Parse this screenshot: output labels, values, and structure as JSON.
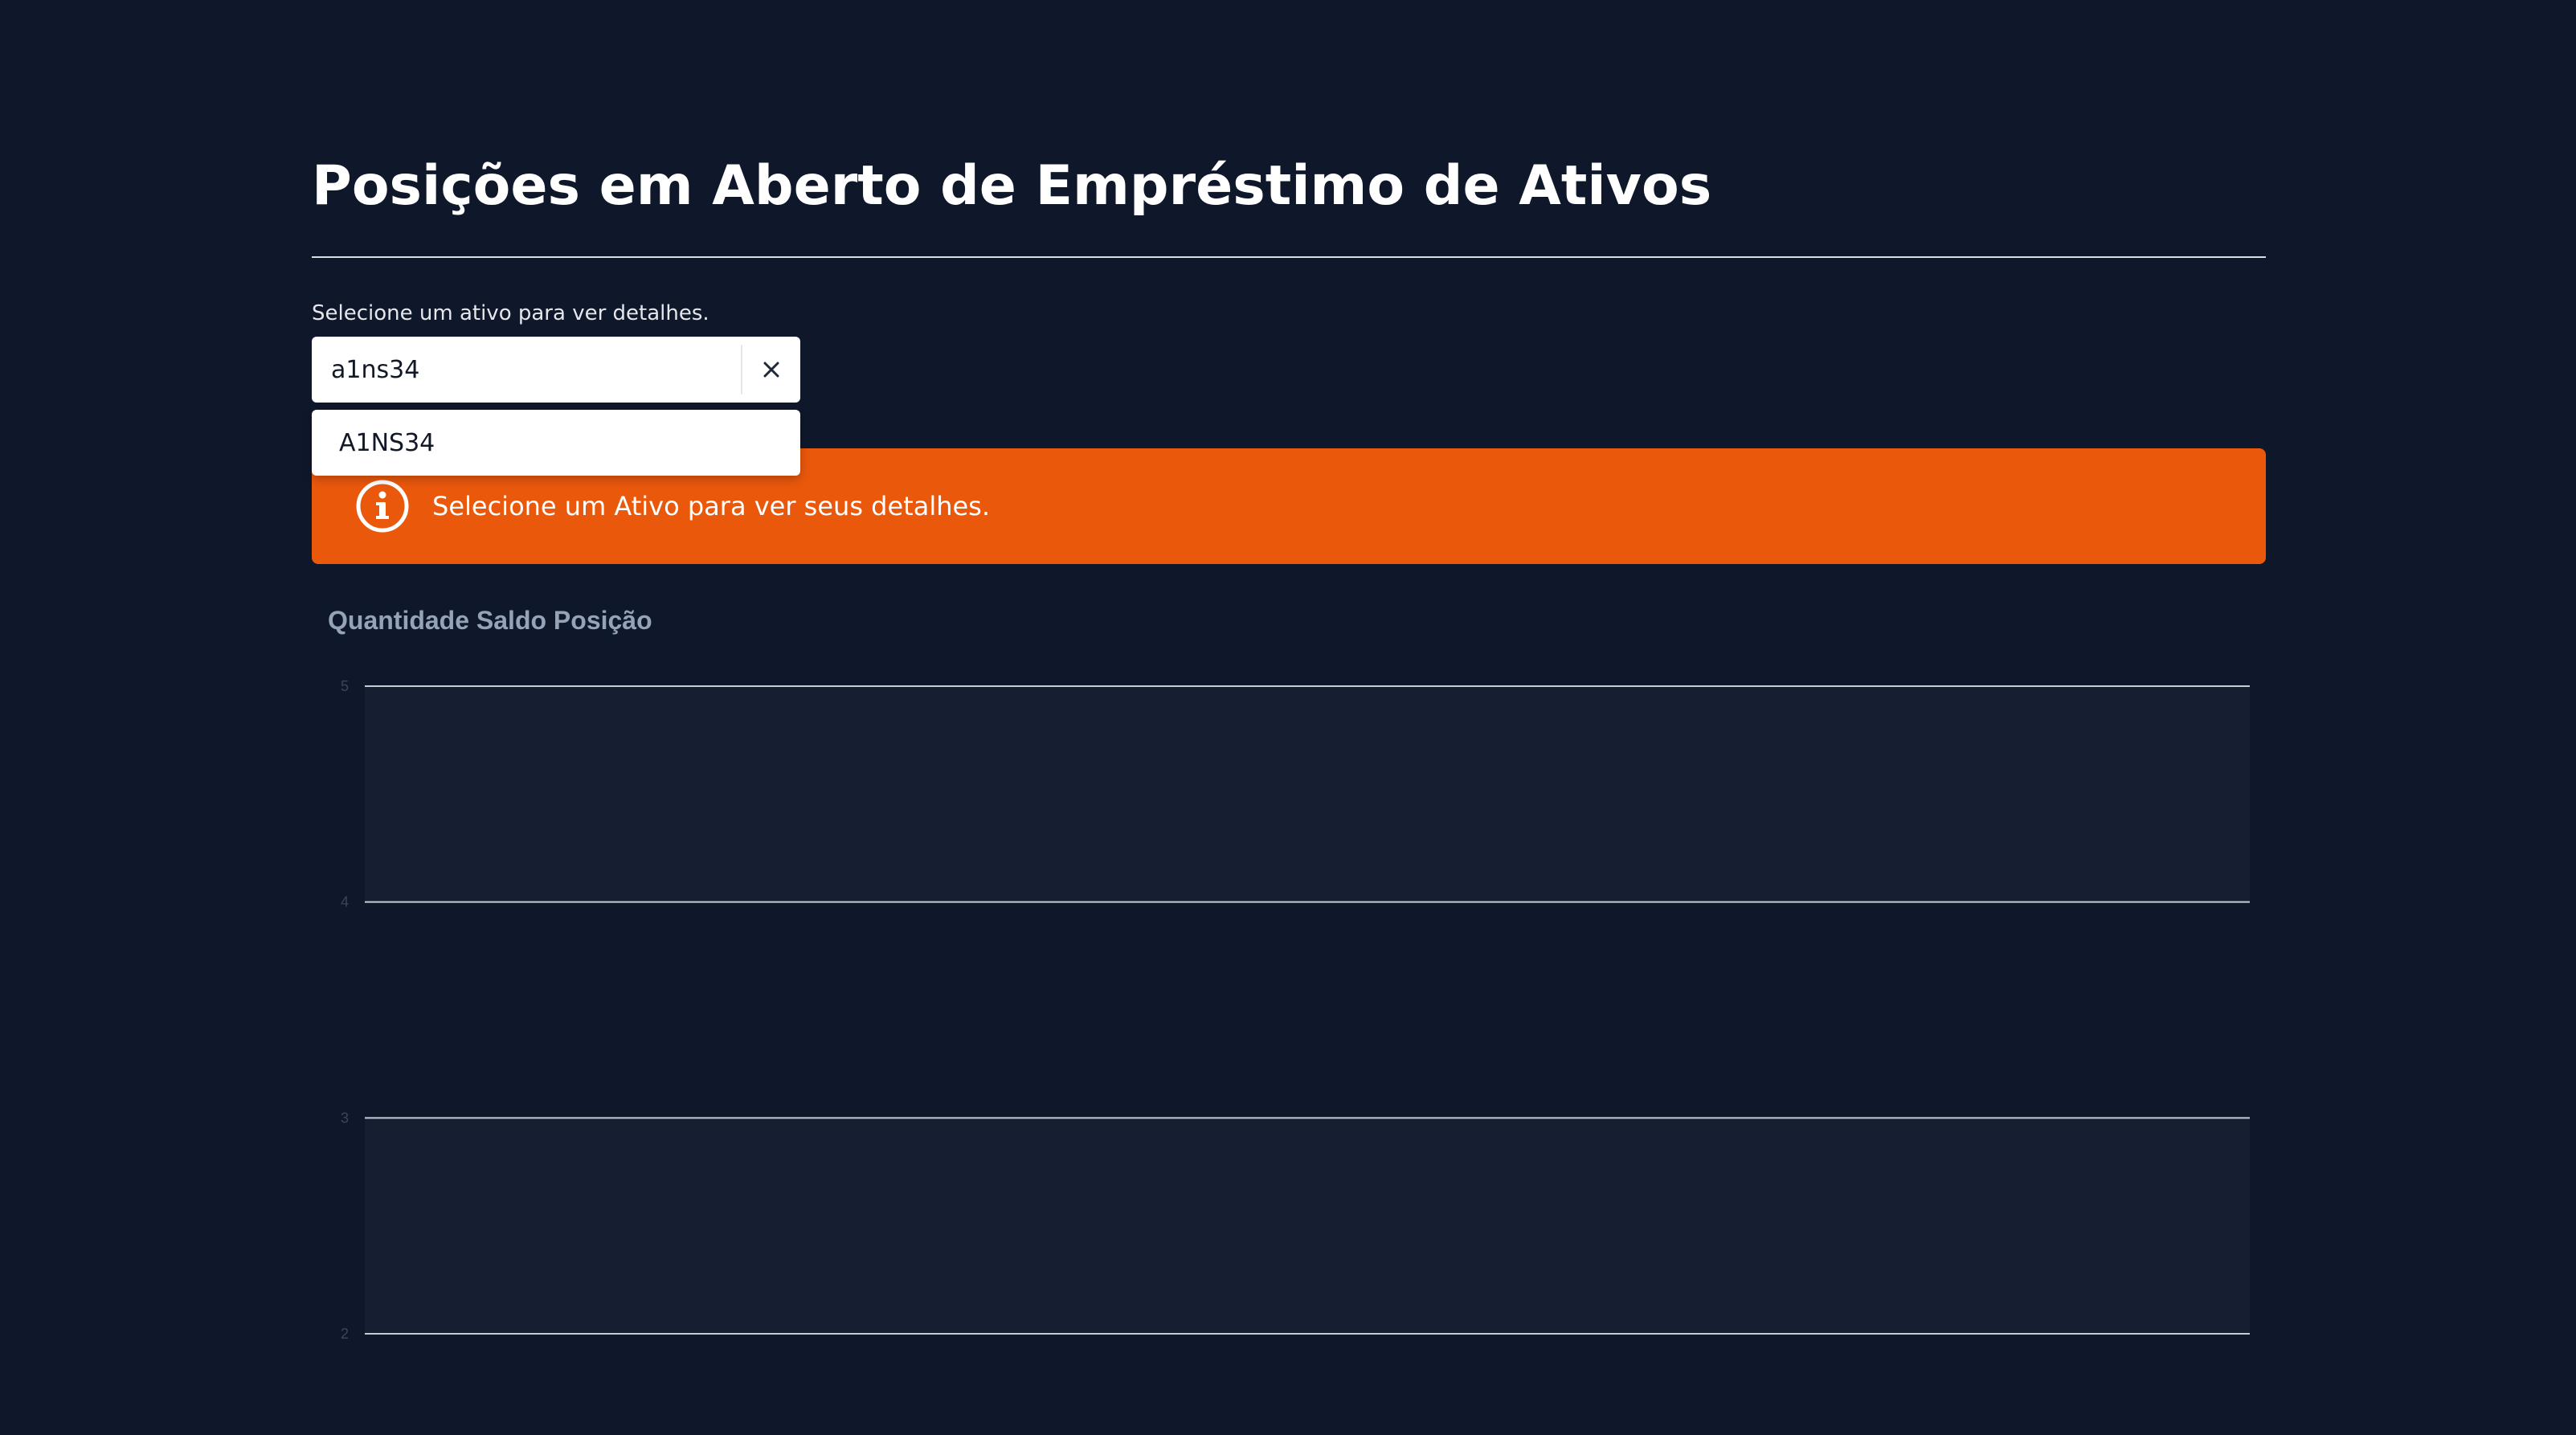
{
  "page": {
    "title": "Posições em Aberto de Empréstimo de Ativos"
  },
  "asset_select": {
    "label": "Selecione um ativo para ver detalhes.",
    "value": "a1ns34",
    "clear_icon": "close-icon",
    "options": [
      "A1NS34"
    ]
  },
  "alert": {
    "icon": "info-icon",
    "text": "Selecione um Ativo para ver seus detalhes.",
    "color": "#ea580c"
  },
  "colors": {
    "background": "#0f172a",
    "band": "#151f31",
    "gridline": "#c8ccd3"
  },
  "chart_data": {
    "type": "line",
    "title": "Quantidade Saldo Posição",
    "xlabel": "",
    "ylabel": "",
    "ylim": [
      2,
      5
    ],
    "yticks": [
      5,
      4,
      3,
      2
    ],
    "grid": true,
    "series": []
  }
}
